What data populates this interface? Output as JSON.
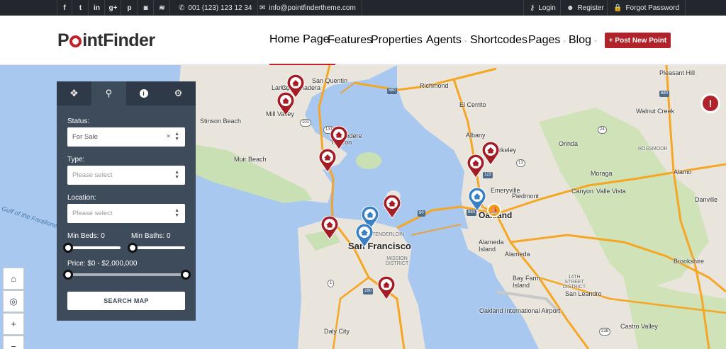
{
  "topbar": {
    "social": [
      {
        "icon": "facebook-icon",
        "glyph": "f"
      },
      {
        "icon": "twitter-icon",
        "glyph": "t"
      },
      {
        "icon": "linkedin-icon",
        "glyph": "in"
      },
      {
        "icon": "googleplus-icon",
        "glyph": "g+"
      },
      {
        "icon": "pinterest-icon",
        "glyph": "p"
      },
      {
        "icon": "instagram-icon",
        "glyph": "◙"
      },
      {
        "icon": "rss-icon",
        "glyph": "≋"
      }
    ],
    "phone": "001 (123) 123 12 34",
    "email": "info@pointfindertheme.com",
    "login": "Login",
    "register": "Register",
    "forgot": "Forgot Password"
  },
  "header": {
    "logo_left": "P",
    "logo_right": "intFinder",
    "nav": [
      "Home Page",
      "Features",
      "Properties",
      "Agents",
      "Shortcodes",
      "Pages",
      "Blog"
    ],
    "post_button": "+ Post New Point"
  },
  "colors": {
    "accent": "#b1232a",
    "panel": "#3d4b5b",
    "marker_red": "#a51d24",
    "marker_blue": "#3a80c4",
    "marker_orange": "#f39c12"
  },
  "panel": {
    "tabs": [
      "move-icon",
      "zoom-icon",
      "info-icon",
      "settings-icon"
    ],
    "status_label": "Status:",
    "status_value": "For Sale",
    "type_label": "Type:",
    "type_placeholder": "Please select",
    "location_label": "Location:",
    "location_placeholder": "Please select",
    "min_beds": "Min Beds: 0",
    "min_baths": "Min Baths: 0",
    "price": "Price: $0 - $2,000,000",
    "search_button": "SEARCH MAP"
  },
  "map": {
    "labels": [
      {
        "text": "San Francisco",
        "cls": "city big"
      },
      {
        "text": "Oakland",
        "cls": "city"
      },
      {
        "text": "Richmond",
        "cls": ""
      },
      {
        "text": "Alameda",
        "cls": ""
      },
      {
        "text": "Walnut Creek",
        "cls": ""
      },
      {
        "text": "Daly City",
        "cls": ""
      },
      {
        "text": "San Leandro",
        "cls": ""
      },
      {
        "text": "Mill Valley",
        "cls": ""
      },
      {
        "text": "San Quentin",
        "cls": ""
      },
      {
        "text": "Larkspur",
        "cls": ""
      },
      {
        "text": "Corte Madera",
        "cls": ""
      },
      {
        "text": "Muir Beach",
        "cls": ""
      },
      {
        "text": "Stinson Beach",
        "cls": ""
      },
      {
        "text": "Tiburon",
        "cls": ""
      },
      {
        "text": "Belvedere",
        "cls": ""
      },
      {
        "text": "El Cerrito",
        "cls": ""
      },
      {
        "text": "Albany",
        "cls": ""
      },
      {
        "text": "Berkeley",
        "cls": ""
      },
      {
        "text": "Emeryville",
        "cls": ""
      },
      {
        "text": "Piedmont",
        "cls": ""
      },
      {
        "text": "Orinda",
        "cls": ""
      },
      {
        "text": "Canyon",
        "cls": ""
      },
      {
        "text": "Valle Vista",
        "cls": ""
      },
      {
        "text": "Moraga",
        "cls": ""
      },
      {
        "text": "Alamo",
        "cls": ""
      },
      {
        "text": "Danville",
        "cls": ""
      },
      {
        "text": "Pleasant Hill",
        "cls": ""
      },
      {
        "text": "Brookshire",
        "cls": ""
      },
      {
        "text": "Castro Valley",
        "cls": ""
      },
      {
        "text": "Bay Farm Island",
        "cls": ""
      },
      {
        "text": "Oakland International Airport",
        "cls": ""
      },
      {
        "text": "Alameda Island",
        "cls": ""
      },
      {
        "text": "Gulf of the Farallones Marine",
        "cls": "water"
      },
      {
        "text": "ROSSMOOR",
        "cls": "small"
      },
      {
        "text": "MISSION DISTRICT",
        "cls": "small"
      },
      {
        "text": "TENDERLOIN",
        "cls": "small"
      },
      {
        "text": "14TH STREET DISTRICT",
        "cls": "small"
      }
    ],
    "shields": [
      "101",
      "131",
      "580",
      "80",
      "880",
      "123",
      "13",
      "24",
      "680",
      "280",
      "1",
      "238"
    ],
    "controls": [
      "home-icon",
      "locate-icon",
      "zoom-in-icon",
      "zoom-out-icon"
    ],
    "alert_marker": "!"
  }
}
